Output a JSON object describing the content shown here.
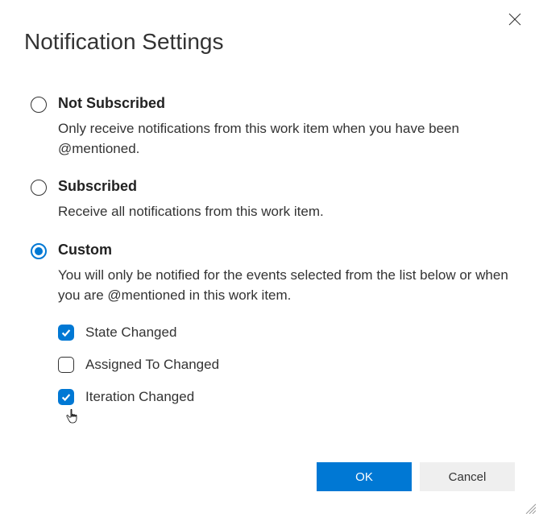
{
  "dialog": {
    "title": "Notification Settings"
  },
  "options": {
    "not_subscribed": {
      "label": "Not Subscribed",
      "description": "Only receive notifications from this work item when you have been @mentioned.",
      "selected": false
    },
    "subscribed": {
      "label": "Subscribed",
      "description": "Receive all notifications from this work item.",
      "selected": false
    },
    "custom": {
      "label": "Custom",
      "description": "You will only be notified for the events selected from the list below or when you are @mentioned in this work item.",
      "selected": true,
      "checkboxes": [
        {
          "label": "State Changed",
          "checked": true
        },
        {
          "label": "Assigned To Changed",
          "checked": false
        },
        {
          "label": "Iteration Changed",
          "checked": true
        }
      ]
    }
  },
  "buttons": {
    "ok": "OK",
    "cancel": "Cancel"
  }
}
